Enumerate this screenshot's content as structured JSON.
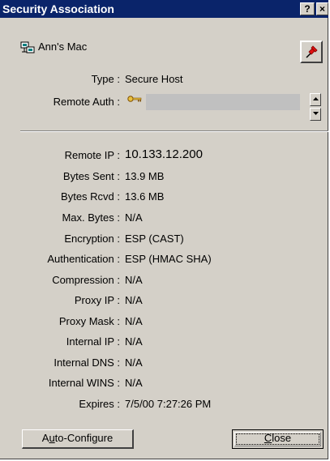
{
  "window": {
    "title": "Security Association",
    "help_label": "?",
    "close_label": "×"
  },
  "host": {
    "name": "Ann's Mac"
  },
  "fields_top": [
    {
      "label": "Type :",
      "value": "Secure Host"
    },
    {
      "label": "Remote Auth :",
      "value": ""
    }
  ],
  "fields": [
    {
      "label": "Remote IP :",
      "value": "10.133.12.200"
    },
    {
      "label": "Bytes Sent :",
      "value": "13.9 MB"
    },
    {
      "label": "Bytes Rcvd :",
      "value": "13.6 MB"
    },
    {
      "label": "Max. Bytes :",
      "value": "N/A"
    },
    {
      "label": "Encryption :",
      "value": "ESP (CAST)"
    },
    {
      "label": "Authentication :",
      "value": "ESP (HMAC SHA)"
    },
    {
      "label": "Compression :",
      "value": "N/A"
    },
    {
      "label": "Proxy IP :",
      "value": "N/A"
    },
    {
      "label": "Proxy Mask :",
      "value": "N/A"
    },
    {
      "label": "Internal IP :",
      "value": "N/A"
    },
    {
      "label": "Internal DNS :",
      "value": "N/A"
    },
    {
      "label": "Internal WINS :",
      "value": "N/A"
    },
    {
      "label": "Expires :",
      "value": "7/5/00 7:27:26 PM"
    }
  ],
  "buttons": {
    "auto_configure": {
      "mnemonic_before": "A",
      "mnemonic": "u",
      "rest": "to-Configure"
    },
    "close": {
      "mnemonic": "C",
      "rest": "lose"
    }
  },
  "colors": {
    "titlebar": "#0a246a",
    "dialog_bg": "#d4d0c8",
    "field_bg": "#c0c0c0"
  },
  "icons": [
    "help-icon",
    "close-icon",
    "computer-icon",
    "pushpin-icon",
    "key-icon",
    "scroll-up-icon",
    "scroll-down-icon"
  ]
}
